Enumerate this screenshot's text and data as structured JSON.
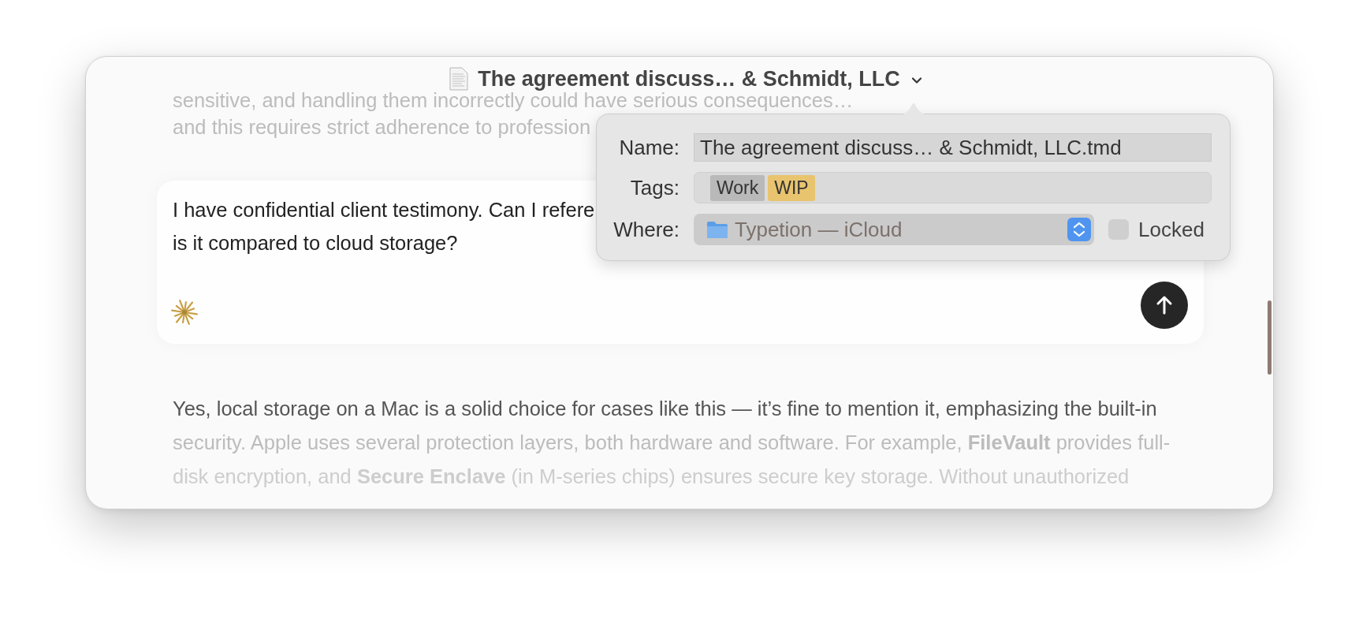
{
  "window": {
    "title": "The agreement discuss… & Schmidt, LLC"
  },
  "info_popover": {
    "name_label": "Name:",
    "name_value": "The agreement discuss… & Schmidt, LLC.tmd",
    "tags_label": "Tags:",
    "tags": [
      {
        "label": "Work",
        "color": "#b9b9b9"
      },
      {
        "label": "WIP",
        "color": "#e9c46f"
      }
    ],
    "where_label": "Where:",
    "where_value": "Typetion — iCloud",
    "locked": {
      "label": "Locked",
      "checked": false
    }
  },
  "transcript": {
    "previous_lines": [
      {
        "text": "sensitive, and handling them incorrectly could have serious consequences…",
        "kind": "faded"
      },
      {
        "text": "and this requires strict adherence to profession",
        "kind": "faded"
      }
    ],
    "prompt_lines": [
      "I have confidential client testimony. Can I refere",
      "is it compared to cloud storage?"
    ],
    "response_lines": [
      {
        "text": "Yes, local storage on a Mac is a solid choice for cases like this — it’s fine to mention it, emphasizing the built-in",
        "kind": "normal"
      },
      {
        "text": "security. Apple uses several protection layers, both hardware and software. For example, **FileVault** provides full-",
        "kind": "faded"
      },
      {
        "text": "disk encryption, and **Secure Enclave** (in M-series chips) ensures secure key storage. Without unauthorized",
        "kind": "faint"
      }
    ]
  }
}
